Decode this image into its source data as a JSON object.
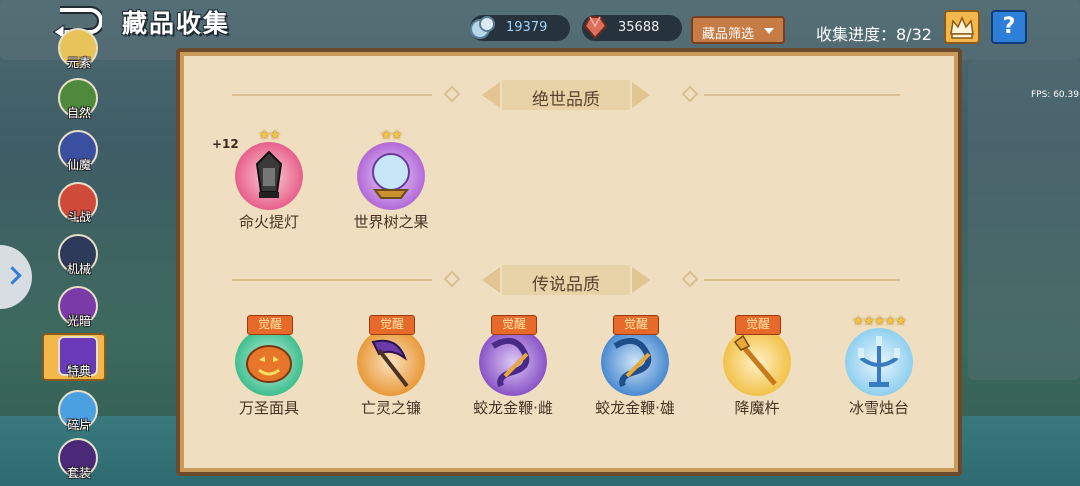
{
  "header": {
    "title": "藏品收集",
    "currency_1": {
      "icon": "ore-icon",
      "value": "19379"
    },
    "currency_2": {
      "icon": "gem-icon",
      "value": "35688"
    },
    "filter_label": "藏品筛选",
    "progress": "收集进度：8/32",
    "help_label": "?",
    "fps": "FPS: 60.39"
  },
  "sidebar": {
    "items": [
      {
        "label": "元素"
      },
      {
        "label": "自然"
      },
      {
        "label": "仙魔"
      },
      {
        "label": "斗战"
      },
      {
        "label": "机械"
      },
      {
        "label": "光暗"
      },
      {
        "label": "特典",
        "active": true
      },
      {
        "label": "碎片"
      },
      {
        "label": "套装"
      }
    ]
  },
  "sections": [
    {
      "title": "绝世品质",
      "items": [
        {
          "name": "命火提灯",
          "stars": "★★",
          "plus": "+12",
          "icon": "lantern-icon",
          "color": "#e8608a"
        },
        {
          "name": "世界树之果",
          "stars": "★★",
          "icon": "crystal-orb-icon",
          "color": "#b36ad8"
        }
      ]
    },
    {
      "title": "传说品质",
      "items": [
        {
          "name": "万圣面具",
          "awaken": "觉醒",
          "icon": "pumpkin-mask-icon",
          "color": "#3fbf8f"
        },
        {
          "name": "亡灵之镰",
          "awaken": "觉醒",
          "icon": "scythe-icon",
          "color": "#e89a3a"
        },
        {
          "name": "蛟龙金鞭·雌",
          "awaken": "觉醒",
          "icon": "dragon-whip-icon",
          "color": "#8a54c8"
        },
        {
          "name": "蛟龙金鞭·雄",
          "awaken": "觉醒",
          "icon": "dragon-whip-icon",
          "color": "#4a8ad0"
        },
        {
          "name": "降魔杵",
          "awaken": "觉醒",
          "icon": "vajra-icon",
          "color": "#f2c24a"
        },
        {
          "name": "冰雪烛台",
          "stars": "★★★★★",
          "icon": "candelabra-icon",
          "color": "#8fd0f0"
        }
      ]
    }
  ]
}
